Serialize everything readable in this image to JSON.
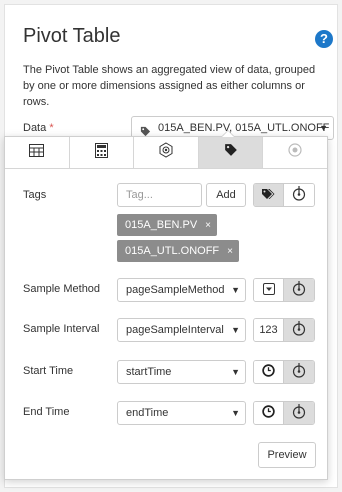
{
  "header": {
    "title": "Pivot Table",
    "help_icon": "?",
    "description": "The Pivot Table shows an aggregated view of data, grouped by one or more dimensions assigned as either columns or rows."
  },
  "data_field": {
    "label": "Data",
    "required_mark": "*",
    "value": "015A_BEN.PV, 015A_UTL.ONOFF"
  },
  "tabs": [
    {
      "icon": "table-icon"
    },
    {
      "icon": "calculator-icon"
    },
    {
      "icon": "settings-icon"
    },
    {
      "icon": "tag-icon",
      "active": true
    },
    {
      "icon": "disabled-circle-icon"
    }
  ],
  "tags_row": {
    "label": "Tags",
    "input_placeholder": "Tag...",
    "add_label": "Add",
    "chips": [
      "015A_BEN.PV",
      "015A_UTL.ONOFF"
    ],
    "chip_remove": "×"
  },
  "sample_method": {
    "label": "Sample Method",
    "value": "pageSampleMethod"
  },
  "sample_interval": {
    "label": "Sample Interval",
    "value": "pageSampleInterval",
    "number_label": "123"
  },
  "start_time": {
    "label": "Start Time",
    "value": "startTime"
  },
  "end_time": {
    "label": "End Time",
    "value": "endTime"
  },
  "preview_label": "Preview",
  "colors": {
    "accent": "#1d78c9",
    "chip": "#8c8c8c",
    "active_tab": "#dcdcdc",
    "required": "#d9534f"
  }
}
